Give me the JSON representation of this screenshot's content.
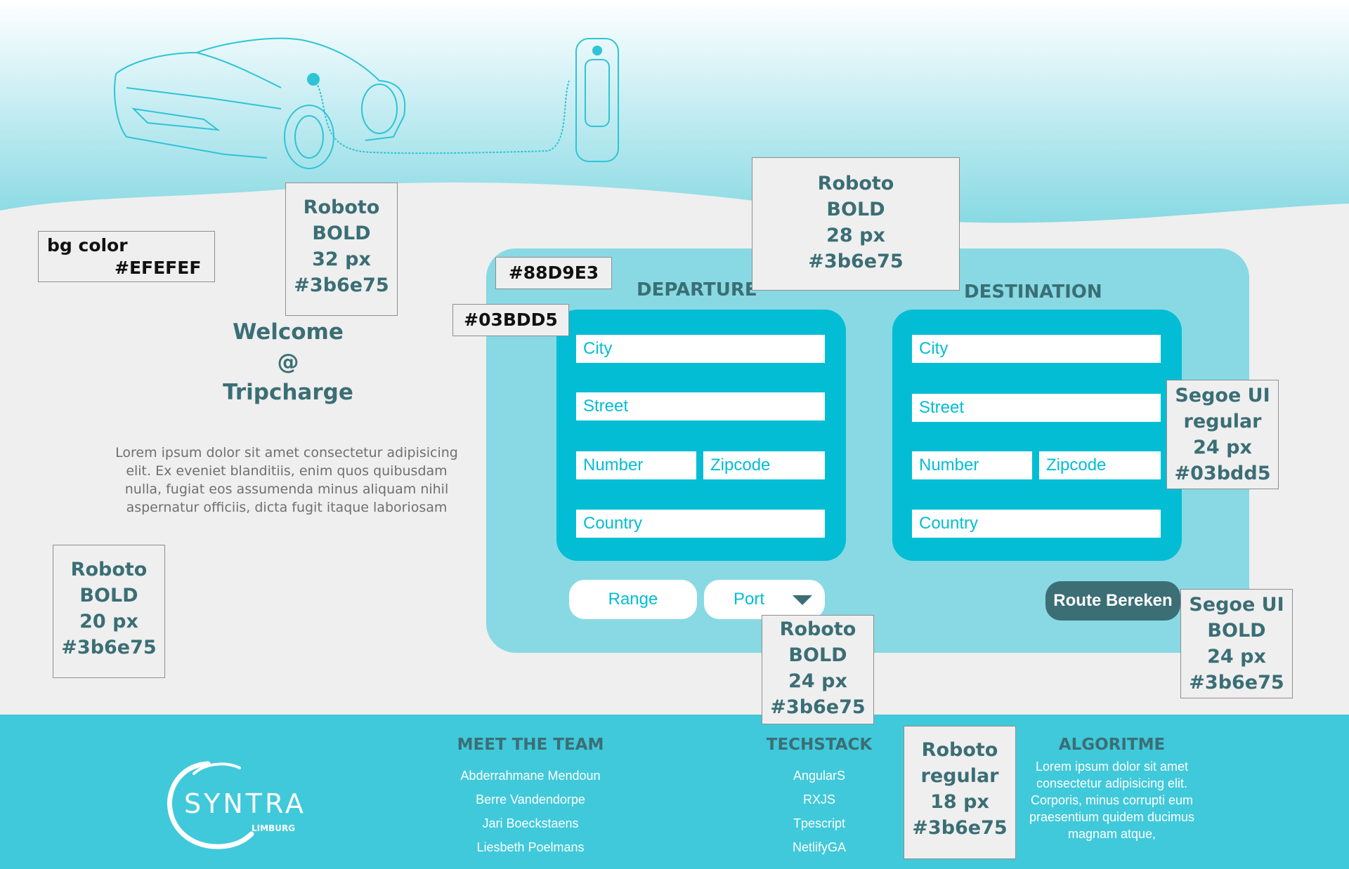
{
  "colors": {
    "background": "#EFEFEF",
    "accent_light": "#88D9E3",
    "accent": "#03BDD5",
    "text_dark": "#3b6e75",
    "footer": "#40C9DA"
  },
  "annotations": {
    "bg_color": [
      "bg color",
      "#EFEFEF"
    ],
    "welcome_font": [
      "Roboto",
      "BOLD",
      "32 px",
      "#3b6e75"
    ],
    "section_font": [
      "Roboto",
      "BOLD",
      "28 px",
      "#3b6e75"
    ],
    "panel_color": "#88D9E3",
    "card_color": "#03BDD5",
    "input_font": [
      "Segoe UI",
      "regular",
      "24 px",
      "#03bdd5"
    ],
    "lorem_font": [
      "Roboto",
      "BOLD",
      "20 px",
      "#3b6e75"
    ],
    "button_font": [
      "Segoe UI",
      "BOLD",
      "24 px",
      "#3b6e75"
    ],
    "footer_heading_font": [
      "Roboto",
      "BOLD",
      "24 px",
      "#3b6e75"
    ],
    "footer_text_font": [
      "Roboto",
      "regular",
      "18 px",
      "#3b6e75"
    ]
  },
  "welcome": [
    "Welcome",
    "@",
    "Tripcharge"
  ],
  "intro": "Lorem ipsum dolor sit amet consectetur adipisicing elit. Ex eveniet blanditiis, enim quos quibusdam nulla, fugiat eos assumenda minus aliquam nihil aspernatur officiis, dicta fugit itaque laboriosam",
  "departure": {
    "title": "DEPARTURE",
    "city": "City",
    "street": "Street",
    "number": "Number",
    "zipcode": "Zipcode",
    "country": "Country"
  },
  "destination": {
    "title": "DESTINATION",
    "city": "City",
    "street": "Street",
    "number": "Number",
    "zipcode": "Zipcode",
    "country": "Country"
  },
  "controls": {
    "range": "Range",
    "port": "Port",
    "route_button": "Route Bereken"
  },
  "footer": {
    "logo_text": "SYNTRA",
    "logo_sub": "LIMBURG",
    "team": {
      "title": "MEET THE TEAM",
      "members": [
        "Abderrahmane Mendoun",
        "Berre Vandendorpe",
        "Jari Boeckstaens",
        "Liesbeth Poelmans"
      ]
    },
    "tech": {
      "title": "TECHSTACK",
      "items": [
        "AngularS",
        "RXJS",
        "Tpescript",
        "NetlifyGA"
      ]
    },
    "algo": {
      "title": "ALGORITME",
      "text": "Lorem ipsum dolor sit amet consectetur adipisicing elit. Corporis, minus corrupti eum praesentium quidem ducimus magnam atque,"
    }
  }
}
